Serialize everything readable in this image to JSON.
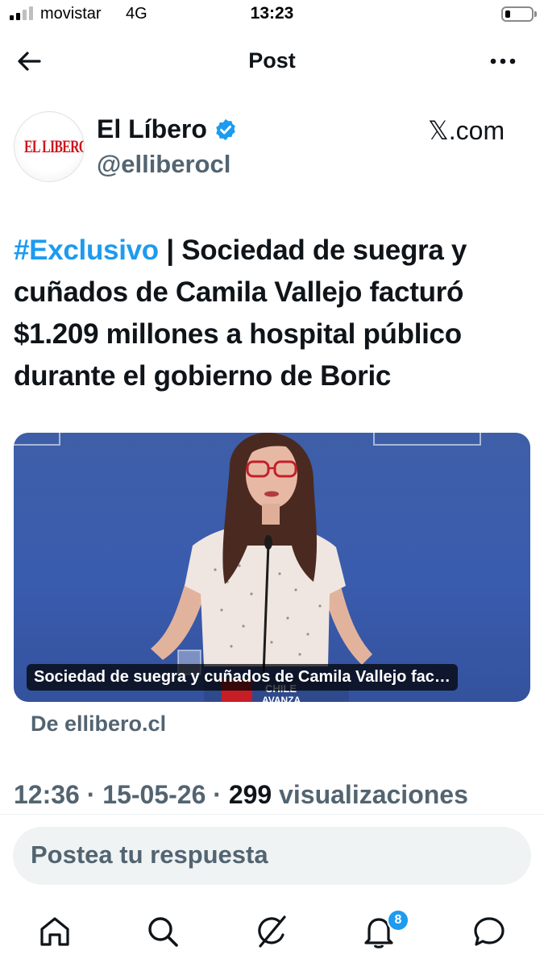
{
  "status_bar": {
    "carrier": "movistar",
    "network": "4G",
    "time": "13:23"
  },
  "header": {
    "title": "Post",
    "back_icon": "arrow-left-icon",
    "more_icon": "more-horizontal-icon"
  },
  "post": {
    "display_name": "El Líbero",
    "handle": "@elliberocl",
    "avatar_logo_text": "EL LIBERO",
    "verified_color": "#1d9bf0",
    "source": "𝕏.com",
    "hashtag": "#Exclusivo",
    "text": " | Sociedad de suegra y cuñados de Camila Vallejo facturó $1.209 millones a hospital público durante el gobierno de Boric",
    "media": {
      "caption": "Sociedad de suegra y cuñados de Camila Vallejo fac…",
      "from": "De ellibero.cl"
    },
    "meta": {
      "time_date": "12:36 · 15-05-26 · ",
      "views_count": "299",
      "views_label": " visualizaciones"
    }
  },
  "reply": {
    "placeholder": "Postea tu respuesta"
  },
  "tabbar": {
    "items": [
      "home-icon",
      "search-icon",
      "grok-icon",
      "notifications-icon",
      "messages-icon"
    ],
    "notifications_badge": "8"
  },
  "colors": {
    "accent": "#1d9bf0",
    "text_primary": "#0f1419",
    "text_secondary": "#536471",
    "logo_red": "#d0141c"
  }
}
